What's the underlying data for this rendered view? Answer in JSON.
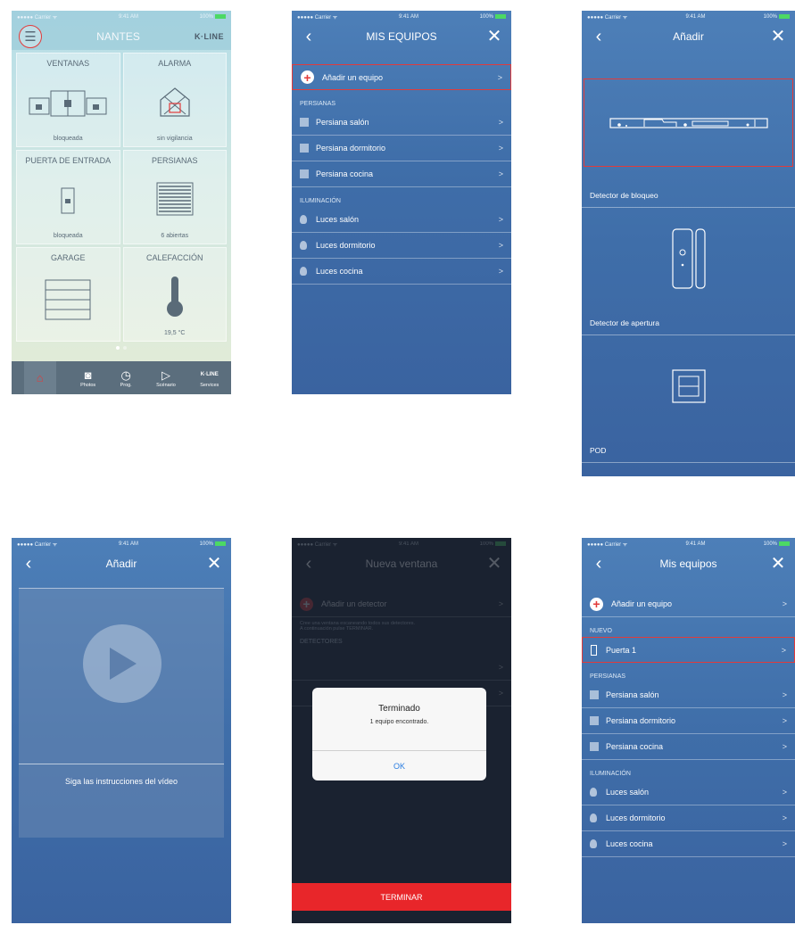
{
  "status": {
    "carrier": "●●●●● Carrier ᯤ",
    "time": "9:41 AM",
    "battery": "100%"
  },
  "screen1": {
    "title": "NANTES",
    "brand": "K·LINE",
    "tiles": [
      {
        "title": "VENTANAS",
        "status": "bloqueada"
      },
      {
        "title": "ALARMA",
        "status": "sin vigilancia"
      },
      {
        "title": "PUERTA DE ENTRADA",
        "status": "bloqueada"
      },
      {
        "title": "PERSIANAS",
        "status": "6 abiertas"
      },
      {
        "title": "GARAGE",
        "status": ""
      },
      {
        "title": "CALEFACCIÓN",
        "status": "19,5 °C"
      }
    ],
    "tabs": [
      "",
      "Photos",
      "Prog.",
      "Scénario",
      "Services"
    ],
    "tab_brand": "K·LINE"
  },
  "screen2": {
    "title": "MIS EQUIPOS",
    "add": "Añadir un equipo",
    "section_blinds": "PERSIANAS",
    "blinds": [
      "Persiana salón",
      "Persiana dormitorio",
      "Persiana cocina"
    ],
    "section_lights": "ILUMINACIÓN",
    "lights": [
      "Luces salón",
      "Luces dormitorio",
      "Luces cocina"
    ]
  },
  "screen3": {
    "title": "Añadir",
    "devices": [
      "Detector de bloqueo",
      "Detector de apertura",
      "POD"
    ]
  },
  "screen4": {
    "title": "Añadir",
    "caption": "Siga las instrucciones del vídeo"
  },
  "screen5": {
    "title": "Nueva ventana",
    "add": "Añadir un detector",
    "hint_1": "Cree una ventana escaneando todos sus detectores.",
    "hint_2": "A continuación pulse TERMINAR.",
    "section": "DETECTORES",
    "alert_title": "Terminado",
    "alert_msg": "1 equipo encontrado.",
    "alert_ok": "OK",
    "finish": "TERMINAR"
  },
  "screen6": {
    "title": "Mis equipos",
    "add": "Añadir un equipo",
    "section_new": "NUEVO",
    "new_item": "Puerta 1",
    "section_blinds": "PERSIANAS",
    "blinds": [
      "Persiana salón",
      "Persiana dormitorio",
      "Persiana cocina"
    ],
    "section_lights": "ILUMINACIÓN",
    "lights": [
      "Luces salón",
      "Luces dormitorio",
      "Luces cocina"
    ]
  }
}
